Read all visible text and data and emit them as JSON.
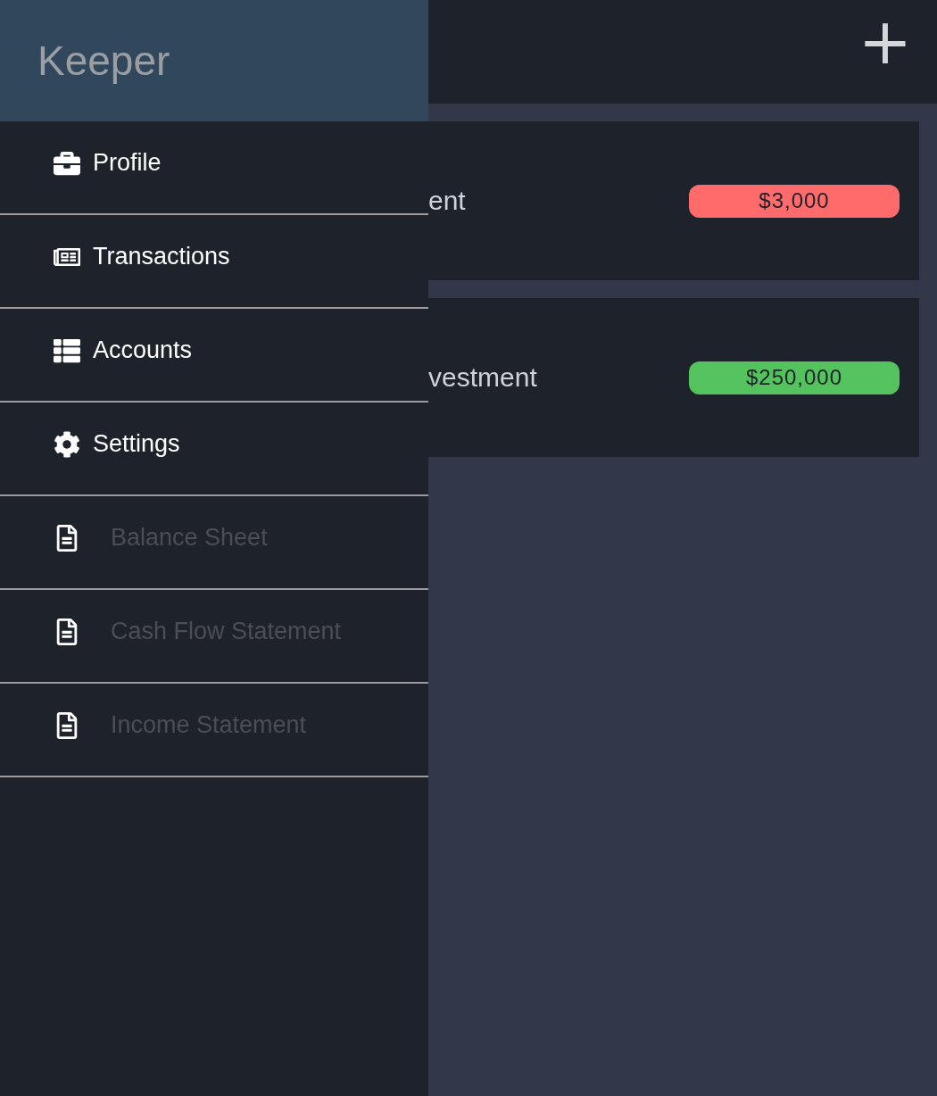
{
  "drawer": {
    "title": "Keeper",
    "items": [
      {
        "label": "Profile",
        "disabled": false
      },
      {
        "label": "Transactions",
        "disabled": false
      },
      {
        "label": "Accounts",
        "disabled": false
      },
      {
        "label": "Settings",
        "disabled": false
      },
      {
        "label": "Balance Sheet",
        "disabled": true
      },
      {
        "label": "Cash Flow Statement",
        "disabled": true
      },
      {
        "label": "Income Statement",
        "disabled": true
      }
    ]
  },
  "header": {
    "add_button": "+"
  },
  "accounts": [
    {
      "name": "ent",
      "amount": "$3,000",
      "color": "#ff6b6b"
    },
    {
      "name": "vestment",
      "amount": "$250,000",
      "color": "#55c35d"
    }
  ]
}
